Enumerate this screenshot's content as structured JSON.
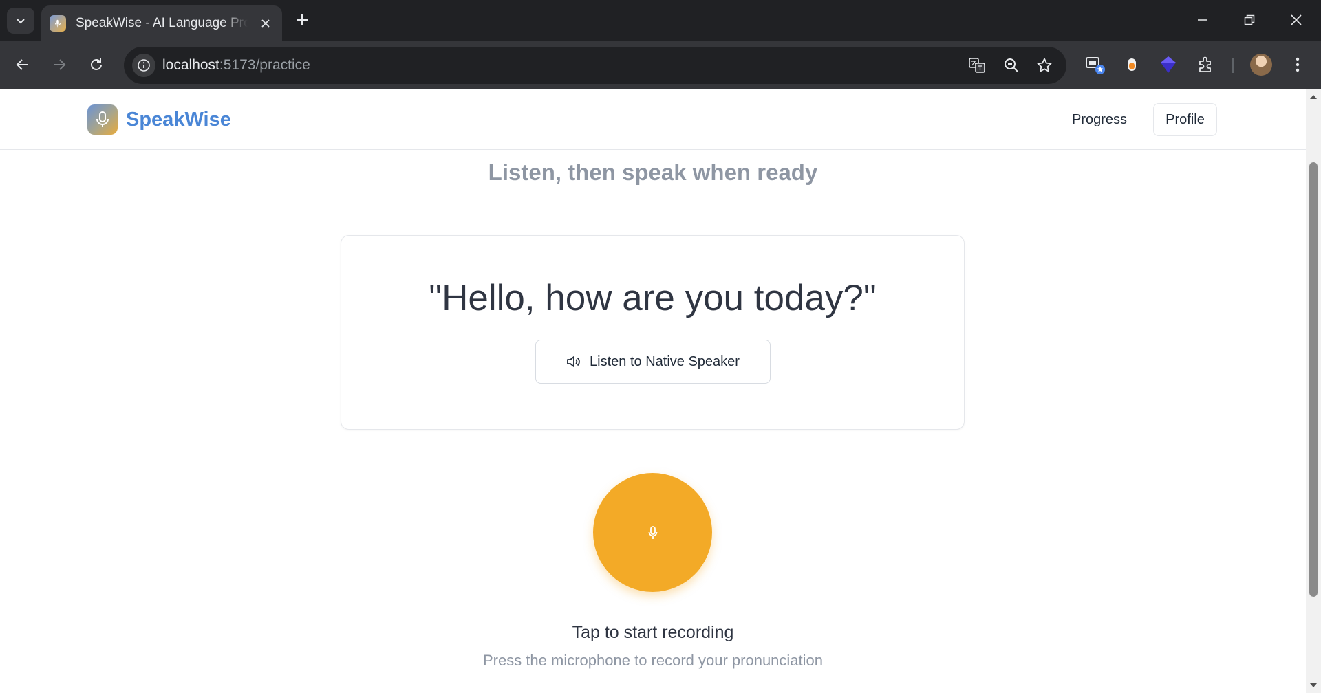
{
  "browser": {
    "tab_title": "SpeakWise - AI Language Pronunciation",
    "url_host": "localhost",
    "url_path": ":5173/practice"
  },
  "header": {
    "logo_text": "SpeakWise",
    "nav": {
      "progress": "Progress",
      "profile": "Profile"
    }
  },
  "practice": {
    "instruction": "Listen, then speak when ready",
    "phrase": "\"Hello, how are you today?\"",
    "listen_button": "Listen to Native Speaker",
    "record_title": "Tap to start recording",
    "record_hint": "Press the microphone to record your pronunciation"
  },
  "colors": {
    "brand_blue": "#4a86d6",
    "mic_orange": "#f3aa27",
    "muted_text": "#8e96a3"
  },
  "icons": [
    "chevron-down-icon",
    "close-icon",
    "plus-icon",
    "minimize-icon",
    "restore-icon",
    "back-icon",
    "forward-icon",
    "reload-icon",
    "info-icon",
    "translate-icon",
    "zoom-out-icon",
    "star-icon",
    "extensions-icon",
    "more-icon",
    "microphone-icon",
    "speaker-icon"
  ]
}
